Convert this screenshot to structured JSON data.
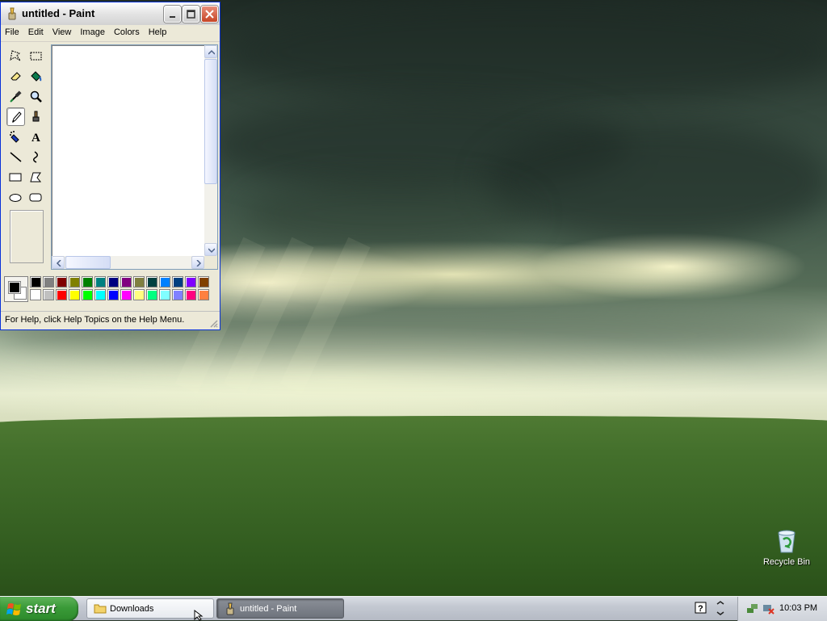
{
  "window": {
    "title": "untitled - Paint",
    "menu": [
      "File",
      "Edit",
      "View",
      "Image",
      "Colors",
      "Help"
    ],
    "status_text": "For Help, click Help Topics on the Help Menu."
  },
  "tools": [
    {
      "name": "free-form-select",
      "icon": "free-form-select-icon"
    },
    {
      "name": "select",
      "icon": "rect-select-icon"
    },
    {
      "name": "eraser",
      "icon": "eraser-icon"
    },
    {
      "name": "fill",
      "icon": "fill-bucket-icon"
    },
    {
      "name": "pick-color",
      "icon": "eyedropper-icon"
    },
    {
      "name": "magnifier",
      "icon": "magnifier-icon"
    },
    {
      "name": "pencil",
      "icon": "pencil-icon",
      "selected": true
    },
    {
      "name": "brush",
      "icon": "brush-icon"
    },
    {
      "name": "airbrush",
      "icon": "airbrush-icon"
    },
    {
      "name": "text",
      "icon": "text-icon",
      "glyph": "A"
    },
    {
      "name": "line",
      "icon": "line-icon"
    },
    {
      "name": "curve",
      "icon": "curve-icon"
    },
    {
      "name": "rectangle",
      "icon": "rectangle-icon"
    },
    {
      "name": "polygon",
      "icon": "polygon-icon"
    },
    {
      "name": "ellipse",
      "icon": "ellipse-icon"
    },
    {
      "name": "rounded-rectangle",
      "icon": "rounded-rectangle-icon"
    }
  ],
  "colors": {
    "foreground": "#000000",
    "background": "#ffffff",
    "palette_row1": [
      "#000000",
      "#808080",
      "#800000",
      "#808000",
      "#008000",
      "#008080",
      "#000080",
      "#800080",
      "#808040",
      "#004040",
      "#0080ff",
      "#004080",
      "#8000ff",
      "#804000"
    ],
    "palette_row2": [
      "#ffffff",
      "#c0c0c0",
      "#ff0000",
      "#ffff00",
      "#00ff00",
      "#00ffff",
      "#0000ff",
      "#ff00ff",
      "#ffff80",
      "#00ff80",
      "#80ffff",
      "#8080ff",
      "#ff0080",
      "#ff8040"
    ]
  },
  "desktop": {
    "icons": [
      {
        "label": "Recycle Bin",
        "icon": "recycle-bin-icon"
      }
    ]
  },
  "taskbar": {
    "start_label": "start",
    "tasks": [
      {
        "label": "Downloads",
        "icon": "folder-icon",
        "active": false
      },
      {
        "label": "untitled - Paint",
        "icon": "paint-icon",
        "active": true
      }
    ],
    "clock": "10:03 PM"
  }
}
